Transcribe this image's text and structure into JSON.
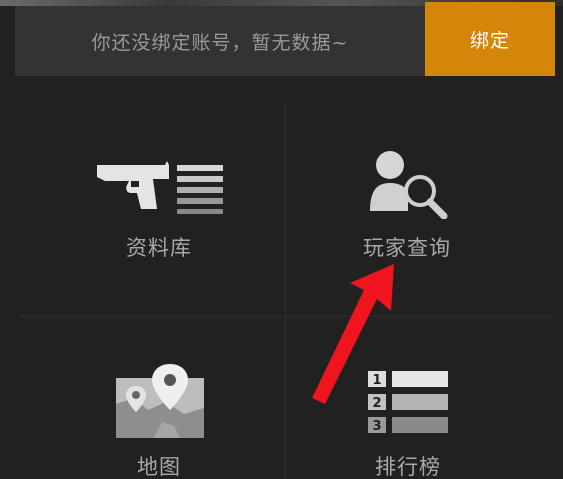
{
  "bind_bar": {
    "message": "你还没绑定账号，暂无数据~",
    "button_label": "绑定"
  },
  "tiles": [
    {
      "label": "资料库",
      "icon": "gun-list-icon"
    },
    {
      "label": "玩家查询",
      "icon": "player-search-icon"
    },
    {
      "label": "地图",
      "icon": "map-pin-icon"
    },
    {
      "label": "排行榜",
      "icon": "ranking-list-icon"
    }
  ],
  "ranking_icon_numbers": [
    "1",
    "2",
    "3"
  ],
  "colors": {
    "background": "#212121",
    "bind_button": "#d4860b",
    "annotation_arrow": "#f0141e"
  }
}
